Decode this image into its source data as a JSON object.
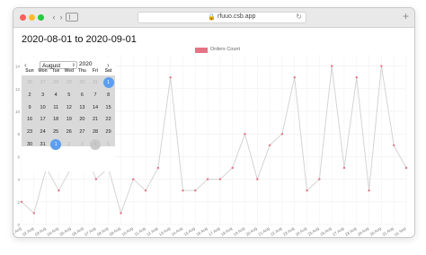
{
  "browser": {
    "url": "rfuuo.csb.app",
    "lock_glyph": "🔒",
    "reload_glyph": "↻",
    "back_glyph": "‹",
    "forward_glyph": "›",
    "newtab_glyph": "+",
    "traffic_colors": [
      "#fe5f57",
      "#febc2e",
      "#28c840"
    ]
  },
  "page": {
    "range_title": "2020-08-01 to 2020-09-01"
  },
  "calendar": {
    "prev_glyph": "‹",
    "next_glyph": "›",
    "month": "August",
    "month_caret": "⇕",
    "year": "2020",
    "weekdays": [
      "Sun",
      "Mon",
      "Tue",
      "Wed",
      "Thu",
      "Fri",
      "Sat"
    ],
    "weeks": [
      [
        {
          "d": "26",
          "out": true
        },
        {
          "d": "27",
          "out": true
        },
        {
          "d": "28",
          "out": true
        },
        {
          "d": "29",
          "out": true
        },
        {
          "d": "30",
          "out": true
        },
        {
          "d": "31",
          "out": true
        },
        {
          "d": "1",
          "sel": true
        }
      ],
      [
        {
          "d": "2"
        },
        {
          "d": "3"
        },
        {
          "d": "4"
        },
        {
          "d": "5"
        },
        {
          "d": "6"
        },
        {
          "d": "7"
        },
        {
          "d": "8"
        }
      ],
      [
        {
          "d": "9"
        },
        {
          "d": "10"
        },
        {
          "d": "11"
        },
        {
          "d": "12"
        },
        {
          "d": "13"
        },
        {
          "d": "14"
        },
        {
          "d": "15"
        }
      ],
      [
        {
          "d": "16"
        },
        {
          "d": "17"
        },
        {
          "d": "18"
        },
        {
          "d": "19"
        },
        {
          "d": "20"
        },
        {
          "d": "21"
        },
        {
          "d": "22"
        }
      ],
      [
        {
          "d": "23"
        },
        {
          "d": "24"
        },
        {
          "d": "25"
        },
        {
          "d": "26"
        },
        {
          "d": "27"
        },
        {
          "d": "28"
        },
        {
          "d": "29"
        }
      ],
      [
        {
          "d": "30"
        },
        {
          "d": "31"
        },
        {
          "d": "1",
          "sel": true,
          "out": true
        },
        {
          "d": "2",
          "out": true
        },
        {
          "d": "3",
          "out": true
        },
        {
          "d": "4",
          "today": true,
          "out": true
        },
        {
          "d": "5",
          "out": true
        }
      ]
    ],
    "selected_color": "#5b9ef0"
  },
  "chart_data": {
    "type": "line",
    "series": [
      {
        "name": "Orders Count",
        "color": "#e57385",
        "line_color": "#d0d0d0",
        "values": [
          2,
          1,
          5,
          3,
          5,
          7,
          4,
          5,
          1,
          4,
          3,
          5,
          13,
          3,
          3,
          4,
          4,
          5,
          8,
          4,
          7,
          8,
          13,
          3,
          4,
          14,
          5,
          13,
          3,
          14,
          7,
          5
        ]
      }
    ],
    "categories": [
      "01 Aug",
      "02 Aug",
      "03 Aug",
      "04 Aug",
      "05 Aug",
      "06 Aug",
      "07 Aug",
      "08 Aug",
      "09 Aug",
      "10 Aug",
      "11 Aug",
      "12 Aug",
      "13 Aug",
      "14 Aug",
      "15 Aug",
      "16 Aug",
      "17 Aug",
      "18 Aug",
      "19 Aug",
      "20 Aug",
      "21 Aug",
      "22 Aug",
      "23 Aug",
      "24 Aug",
      "25 Aug",
      "26 Aug",
      "27 Aug",
      "28 Aug",
      "29 Aug",
      "30 Aug",
      "31 Aug",
      "01 Sep"
    ],
    "y_ticks": [
      0,
      2,
      4,
      6,
      8,
      10,
      12,
      14
    ],
    "ylim": [
      0,
      15
    ],
    "grid": true,
    "legend_position": "top"
  }
}
